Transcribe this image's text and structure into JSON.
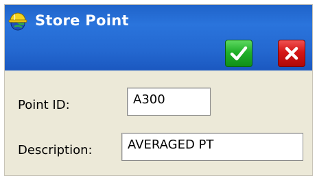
{
  "window": {
    "title": "Store Point",
    "icon": "hardhat-globe-icon"
  },
  "toolbar": {
    "ok_icon": "checkmark-icon",
    "cancel_icon": "close-icon",
    "ok_color": "#21b02a",
    "cancel_color": "#d41616"
  },
  "form": {
    "point_id": {
      "label": "Point ID:",
      "value": "A300"
    },
    "description": {
      "label": "Description:",
      "value": "AVERAGED PT"
    }
  },
  "colors": {
    "titlebar": "#2468d0",
    "dialog_bg": "#ece9d8"
  }
}
